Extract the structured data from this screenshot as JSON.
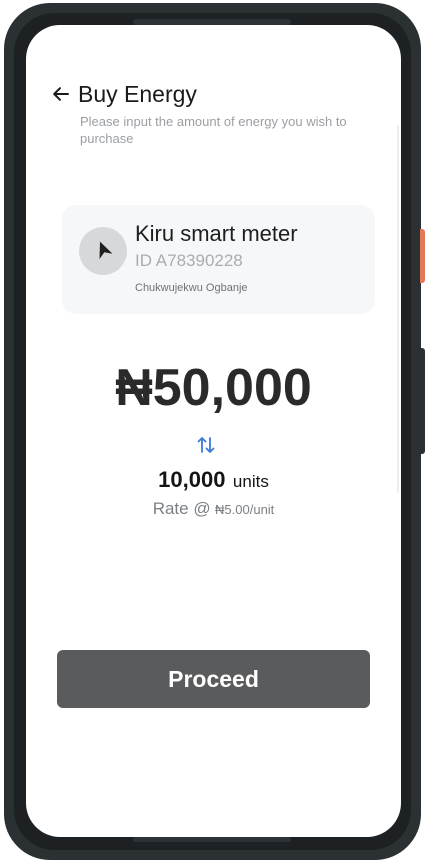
{
  "header": {
    "title": "Buy Energy",
    "subtitle": "Please input the amount of energy you wish to purchase",
    "back_icon": "arrow-left-icon"
  },
  "meter": {
    "name": "Kiru smart meter",
    "id": "ID A78390228",
    "owner": "Chukwujekwu Ogbanje",
    "icon": "navigation-arrow-icon"
  },
  "purchase": {
    "amount": "₦50,000",
    "swap_icon": "swap-vertical-icon",
    "units_value": "10,000",
    "units_label": "units",
    "rate_label": "Rate @",
    "rate_value": "₦5.00/unit"
  },
  "actions": {
    "proceed_label": "Proceed"
  },
  "colors": {
    "accent": "#3a7bd5",
    "button": "#5a5b5c",
    "card": "#f6f7f8",
    "device_button": "#e2785a"
  }
}
